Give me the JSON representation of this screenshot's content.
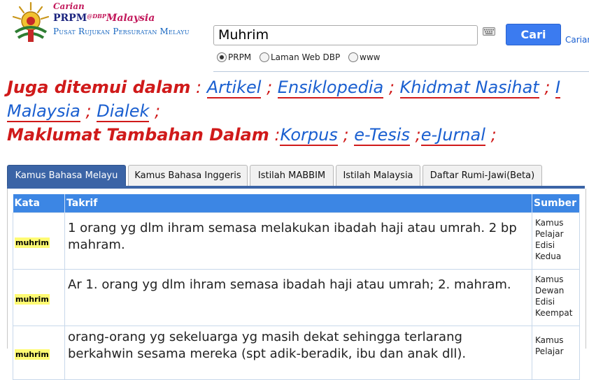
{
  "header": {
    "logo_cari": "Carian",
    "logo_prpm": "PRPM",
    "logo_sup": "@DBP",
    "logo_malaysia": "Malaysia",
    "logo_subtitle": "Pusat Rujukan Persuratan Melayu"
  },
  "search": {
    "value": "Muhrim",
    "button_label": "Cari",
    "link_label": "Cariar",
    "options": [
      "PRPM",
      "Laman Web DBP",
      "www"
    ],
    "selected": "PRPM"
  },
  "also_found": {
    "label": "Juga ditemui dalam",
    "links": [
      "Artikel",
      "Ensiklopedia",
      "Khidmat Nasihat",
      "Malaysia",
      "Dialek"
    ],
    "extra_label": "Maklumat Tambahan Dalam",
    "extra_links": [
      "Korpus",
      "e-Tesis",
      "e-Jurnal"
    ]
  },
  "tabs": [
    {
      "label": "Kamus Bahasa Melayu",
      "active": true
    },
    {
      "label": "Kamus Bahasa Inggeris",
      "active": false
    },
    {
      "label": "Istilah MABBIM",
      "active": false
    },
    {
      "label": "Istilah Malaysia",
      "active": false
    },
    {
      "label": "Daftar Rumi-Jawi(Beta)",
      "active": false
    }
  ],
  "table": {
    "headers": [
      "Kata",
      "Takrif",
      "Sumber"
    ],
    "rows": [
      {
        "kata": "muhrim",
        "takrif": "1 orang yg dlm ihram semasa melakukan ibadah haji atau umrah. 2 bp mahram.",
        "sumber": [
          "Kamus",
          "Pelajar",
          "Edisi",
          "Kedua"
        ]
      },
      {
        "kata": "muhrim",
        "takrif": "Ar 1. orang yg dlm ihram semasa ibadah haji atau umrah; 2. mahram.",
        "sumber": [
          "Kamus",
          "Dewan",
          "Edisi",
          "Keempat"
        ]
      },
      {
        "kata": "muhrim",
        "takrif": "orang-orang yg sekeluarga yg masih dekat sehingga terlarang berkahwin sesama mereka (spt adik-beradik, ibu dan anak dll).",
        "sumber": [
          "Kamus",
          "Pelajar"
        ]
      }
    ]
  },
  "colors": {
    "accent_red": "#d01a1a",
    "link_blue": "#1a5fd0",
    "tab_active": "#3b64a6",
    "table_header": "#3c86e4",
    "button_blue": "#3b7bf0"
  }
}
